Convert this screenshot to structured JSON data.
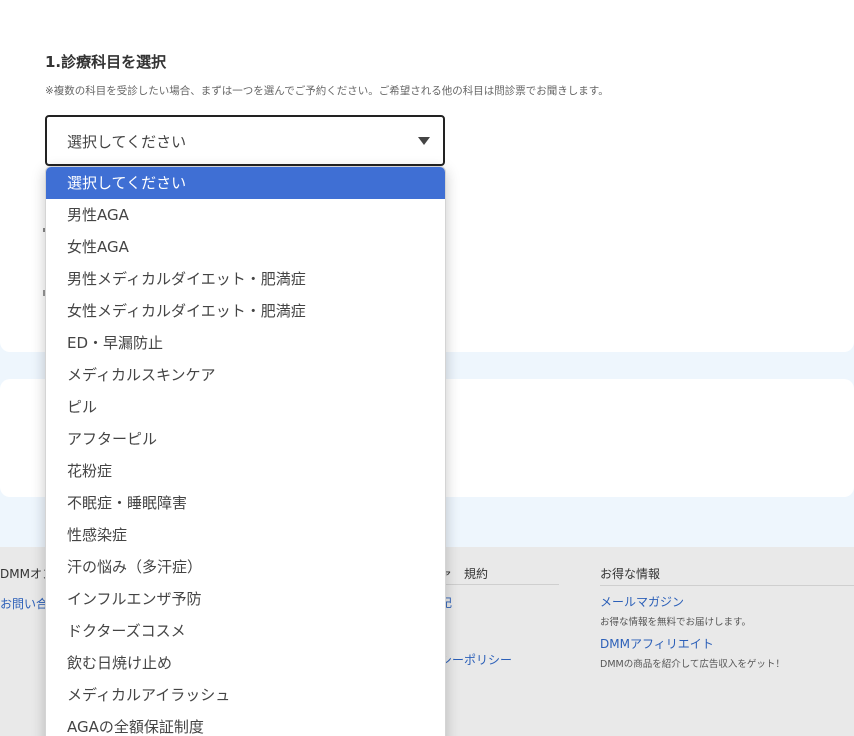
{
  "section": {
    "title": "1.診療科目を選択",
    "note": "※複数の科目を受診したい場合、まずは一つを選んでご予約ください。ご希望される他の科目は問診票でお聞きします。"
  },
  "select": {
    "value": "選択してください",
    "options": [
      "選択してください",
      "男性AGA",
      "女性AGA",
      "男性メディカルダイエット・肥満症",
      "女性メディカルダイエット・肥満症",
      "ED・早漏防止",
      "メディカルスキンケア",
      "ピル",
      "アフターピル",
      "花粉症",
      "不眠症・睡眠障害",
      "性感染症",
      "汗の悩み（多汗症）",
      "インフルエンザ予防",
      "ドクターズコスメ",
      "飲む日焼け止め",
      "メディカルアイラッシュ",
      "AGAの全額保証制度"
    ],
    "selected_index": 0
  },
  "footer": {
    "left_title": "DMMオン",
    "left_link": "お問い合",
    "mid_title": "ァ　規約",
    "mid_link1": "記",
    "mid_link2": "シーポリシー",
    "right_title": "お得な情報",
    "links": [
      {
        "label": "メールマガジン",
        "desc": "お得な情報を無料でお届けします。"
      },
      {
        "label": "DMMアフィリエイト",
        "desc": "DMMの商品を紹介して広告収入をゲット！"
      }
    ]
  },
  "colors": {
    "accent": "#3f6fd4",
    "link": "#2b5fb8",
    "page_bg": "#eef6fd",
    "footer_bg": "#e9e9e9"
  }
}
